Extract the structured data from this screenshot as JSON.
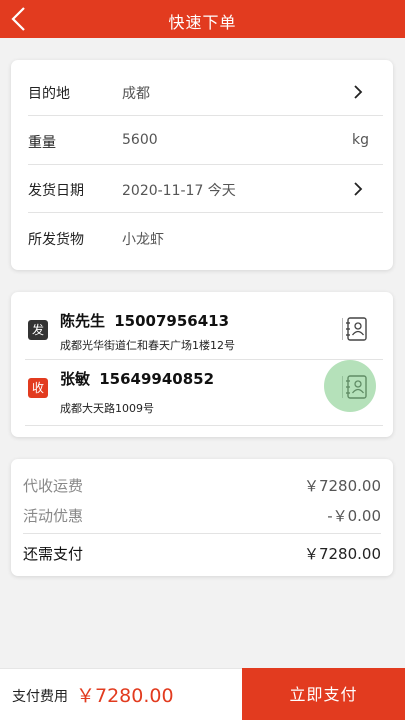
{
  "header": {
    "title": "快速下单",
    "back_icon": "chevron-left-icon"
  },
  "order": {
    "rows": [
      {
        "label": "目的地",
        "value": "成都",
        "unit": "",
        "has_chevron": true
      },
      {
        "label": "重量",
        "value": "5600",
        "unit": "kg",
        "has_chevron": false
      },
      {
        "label": "发货日期",
        "value": "2020-11-17 今天",
        "unit": "",
        "has_chevron": true
      },
      {
        "label": "所发货物",
        "value": "小龙虾",
        "unit": "",
        "has_chevron": false
      }
    ]
  },
  "contacts": {
    "sender": {
      "tag": "发",
      "name": "陈先生",
      "phone": "15007956413",
      "address": "成都光华街道仁和春天广场1楼12号"
    },
    "receiver": {
      "tag": "收",
      "name": "张敏",
      "phone": "15649940852",
      "address": "成都大天路1009号"
    }
  },
  "fees": {
    "freight_label": "代收运费",
    "freight_value": "￥7280.00",
    "discount_label": "活动优惠",
    "discount_value": "-￥0.00",
    "total_label": "还需支付",
    "total_value": "￥7280.00"
  },
  "footer": {
    "pay_label": "支付费用",
    "pay_amount": "￥7280.00",
    "pay_button": "立即支付"
  },
  "colors": {
    "brand": "#e23b1f",
    "background": "#f2f2f2",
    "touch_indicator": "#78c882"
  }
}
